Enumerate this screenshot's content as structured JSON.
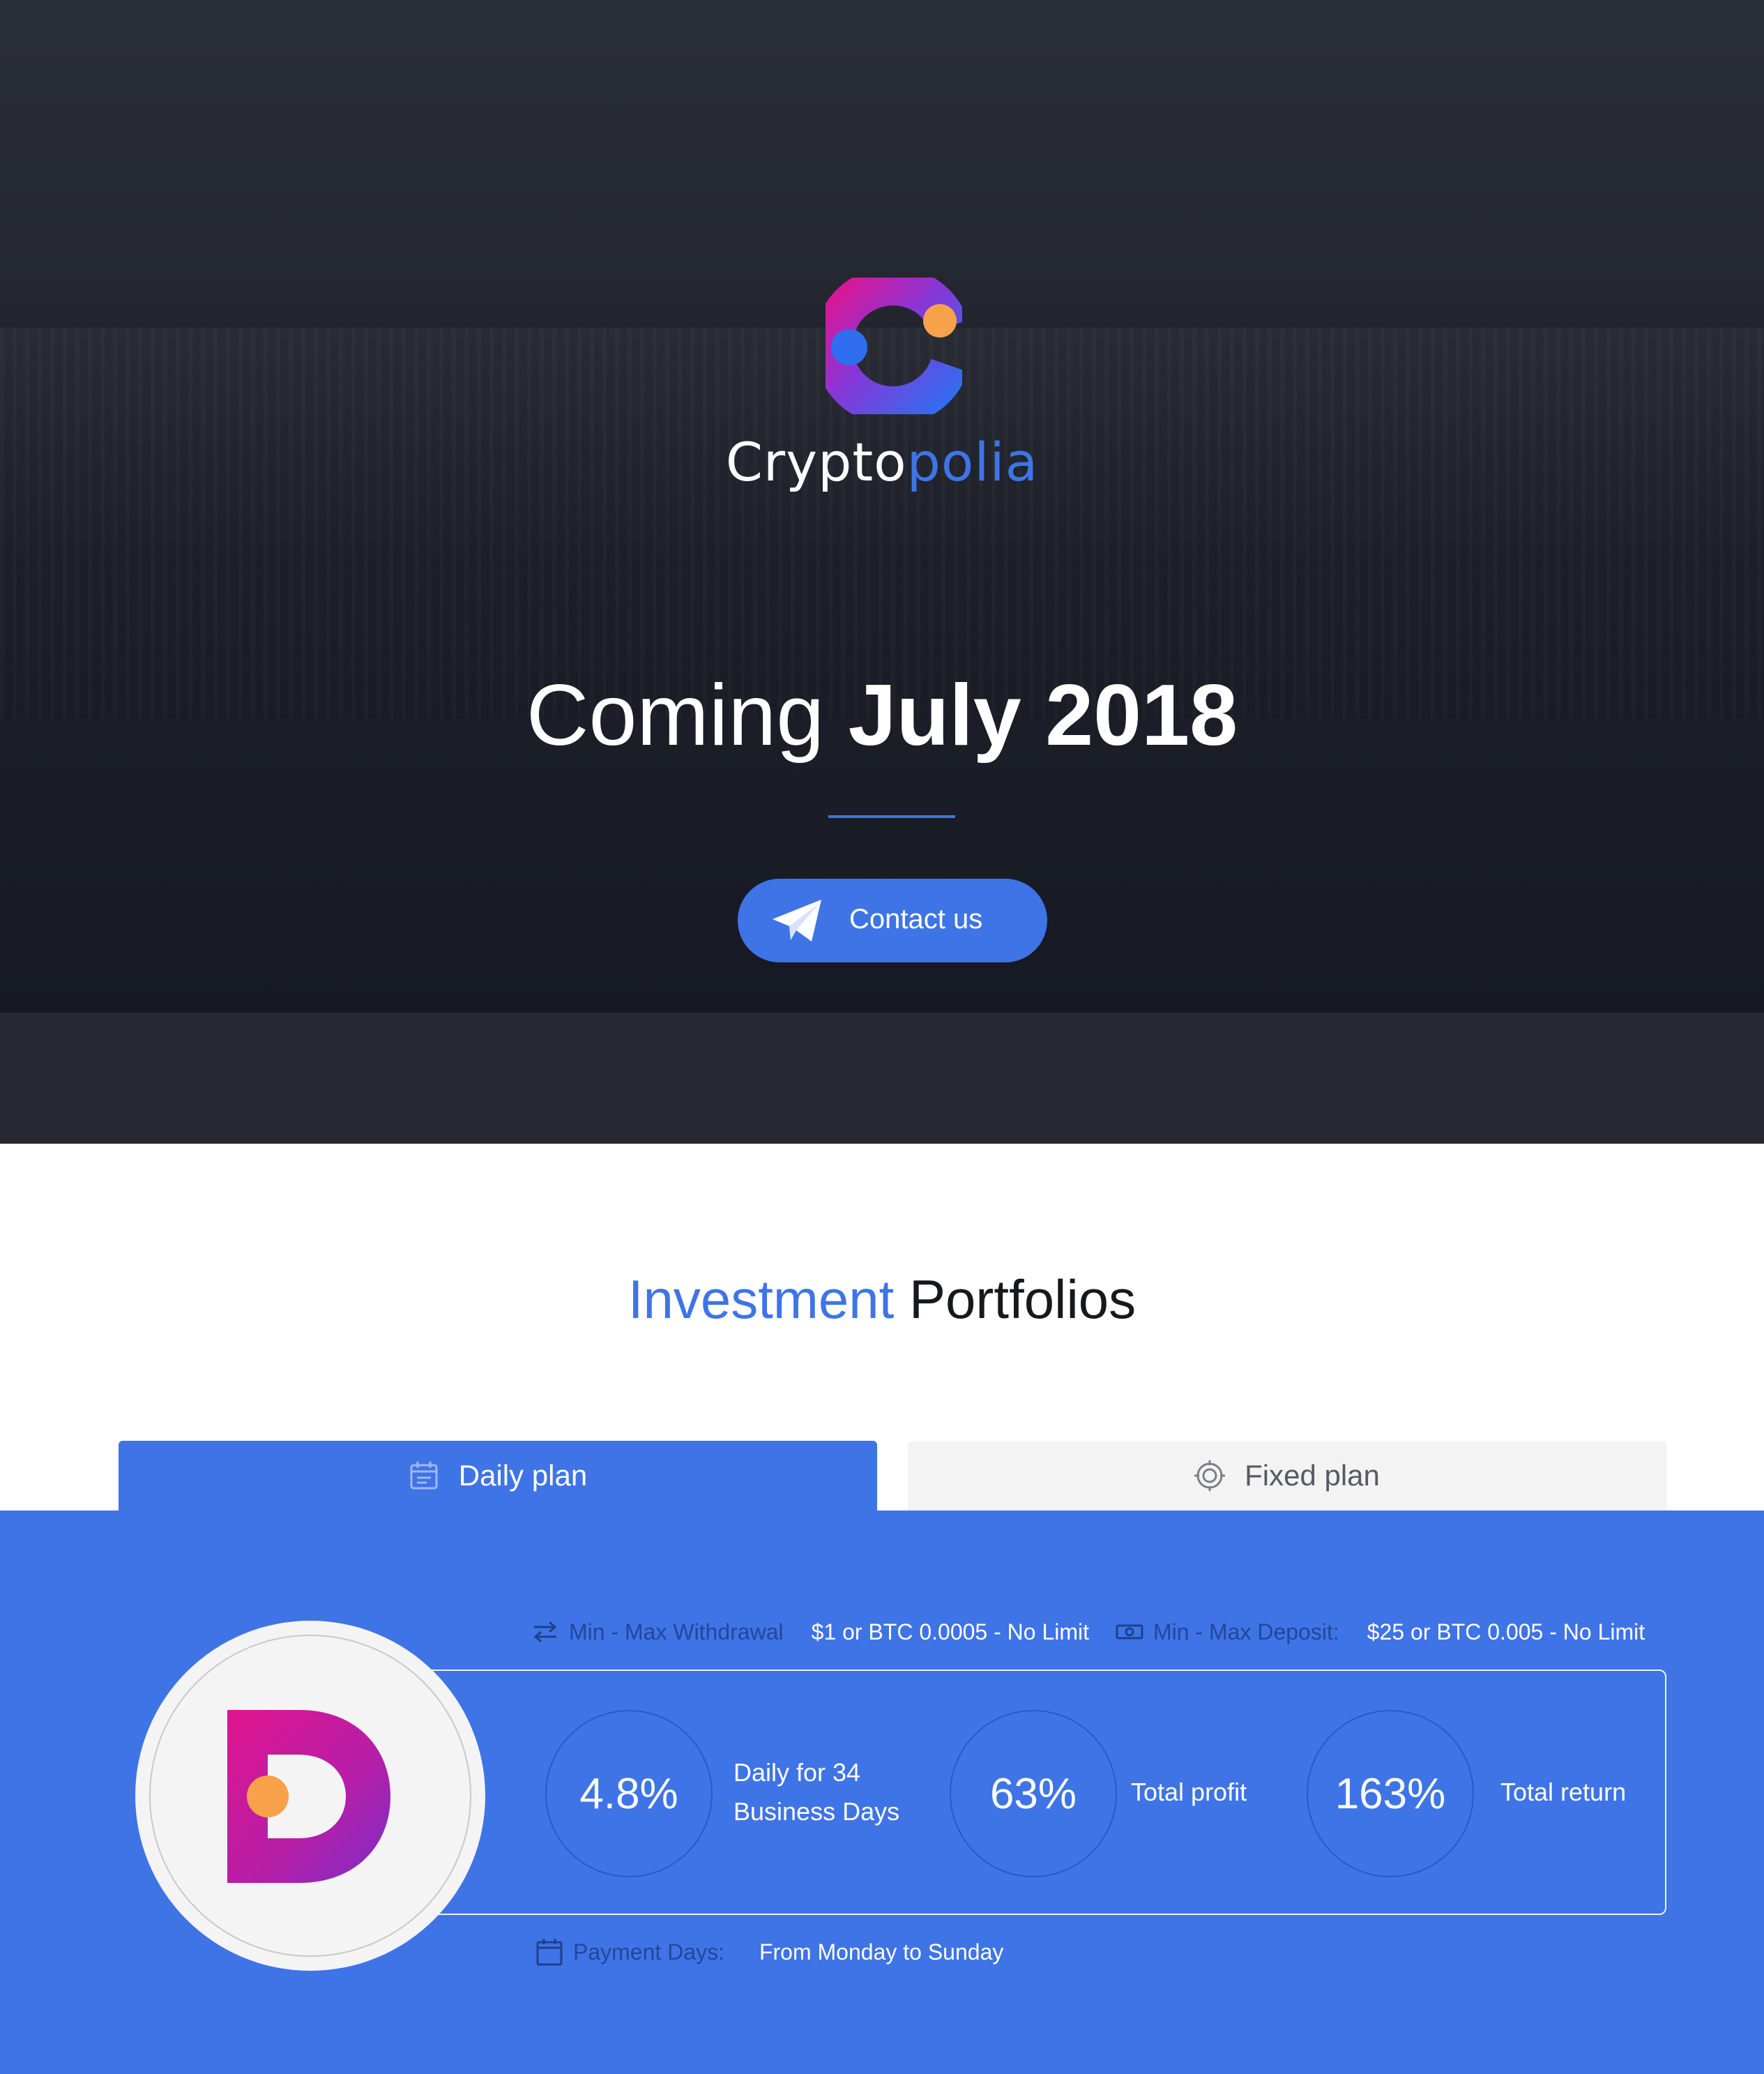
{
  "brand": {
    "name_part1": "Crypto",
    "name_part2": "polia",
    "colors": {
      "accent": "#3f74e6",
      "magenta": "#e0148f",
      "orange": "#f7a24b",
      "dark": "#1b1e27"
    }
  },
  "hero": {
    "headline_light": "Coming ",
    "headline_bold": "July 2018",
    "contact_button": {
      "label": "Contact us",
      "icon": "paper-plane-icon"
    }
  },
  "portfolios": {
    "title_accent": "Investment",
    "title_rest": " Portfolios",
    "tabs": [
      {
        "label": "Daily plan",
        "icon": "calendar-icon",
        "active": true
      },
      {
        "label": "Fixed plan",
        "icon": "target-icon",
        "active": false
      }
    ],
    "limits": {
      "withdrawal_label": "Min - Max Withdrawal",
      "withdrawal_value": "$1 or BTC 0.0005 - No Limit",
      "deposit_label": "Min - Max Deposit:",
      "deposit_value": "$25 or BTC 0.005 - No Limit"
    },
    "stats": [
      {
        "value": "4.8%",
        "label_line1": "Daily for 34",
        "label_line2": "Business Days"
      },
      {
        "value": "63%",
        "label_line1": "Total profit"
      },
      {
        "value": "163%",
        "label_line1": "Total return"
      }
    ],
    "payment": {
      "label": "Payment Days:",
      "value": "From Monday to Sunday"
    }
  }
}
